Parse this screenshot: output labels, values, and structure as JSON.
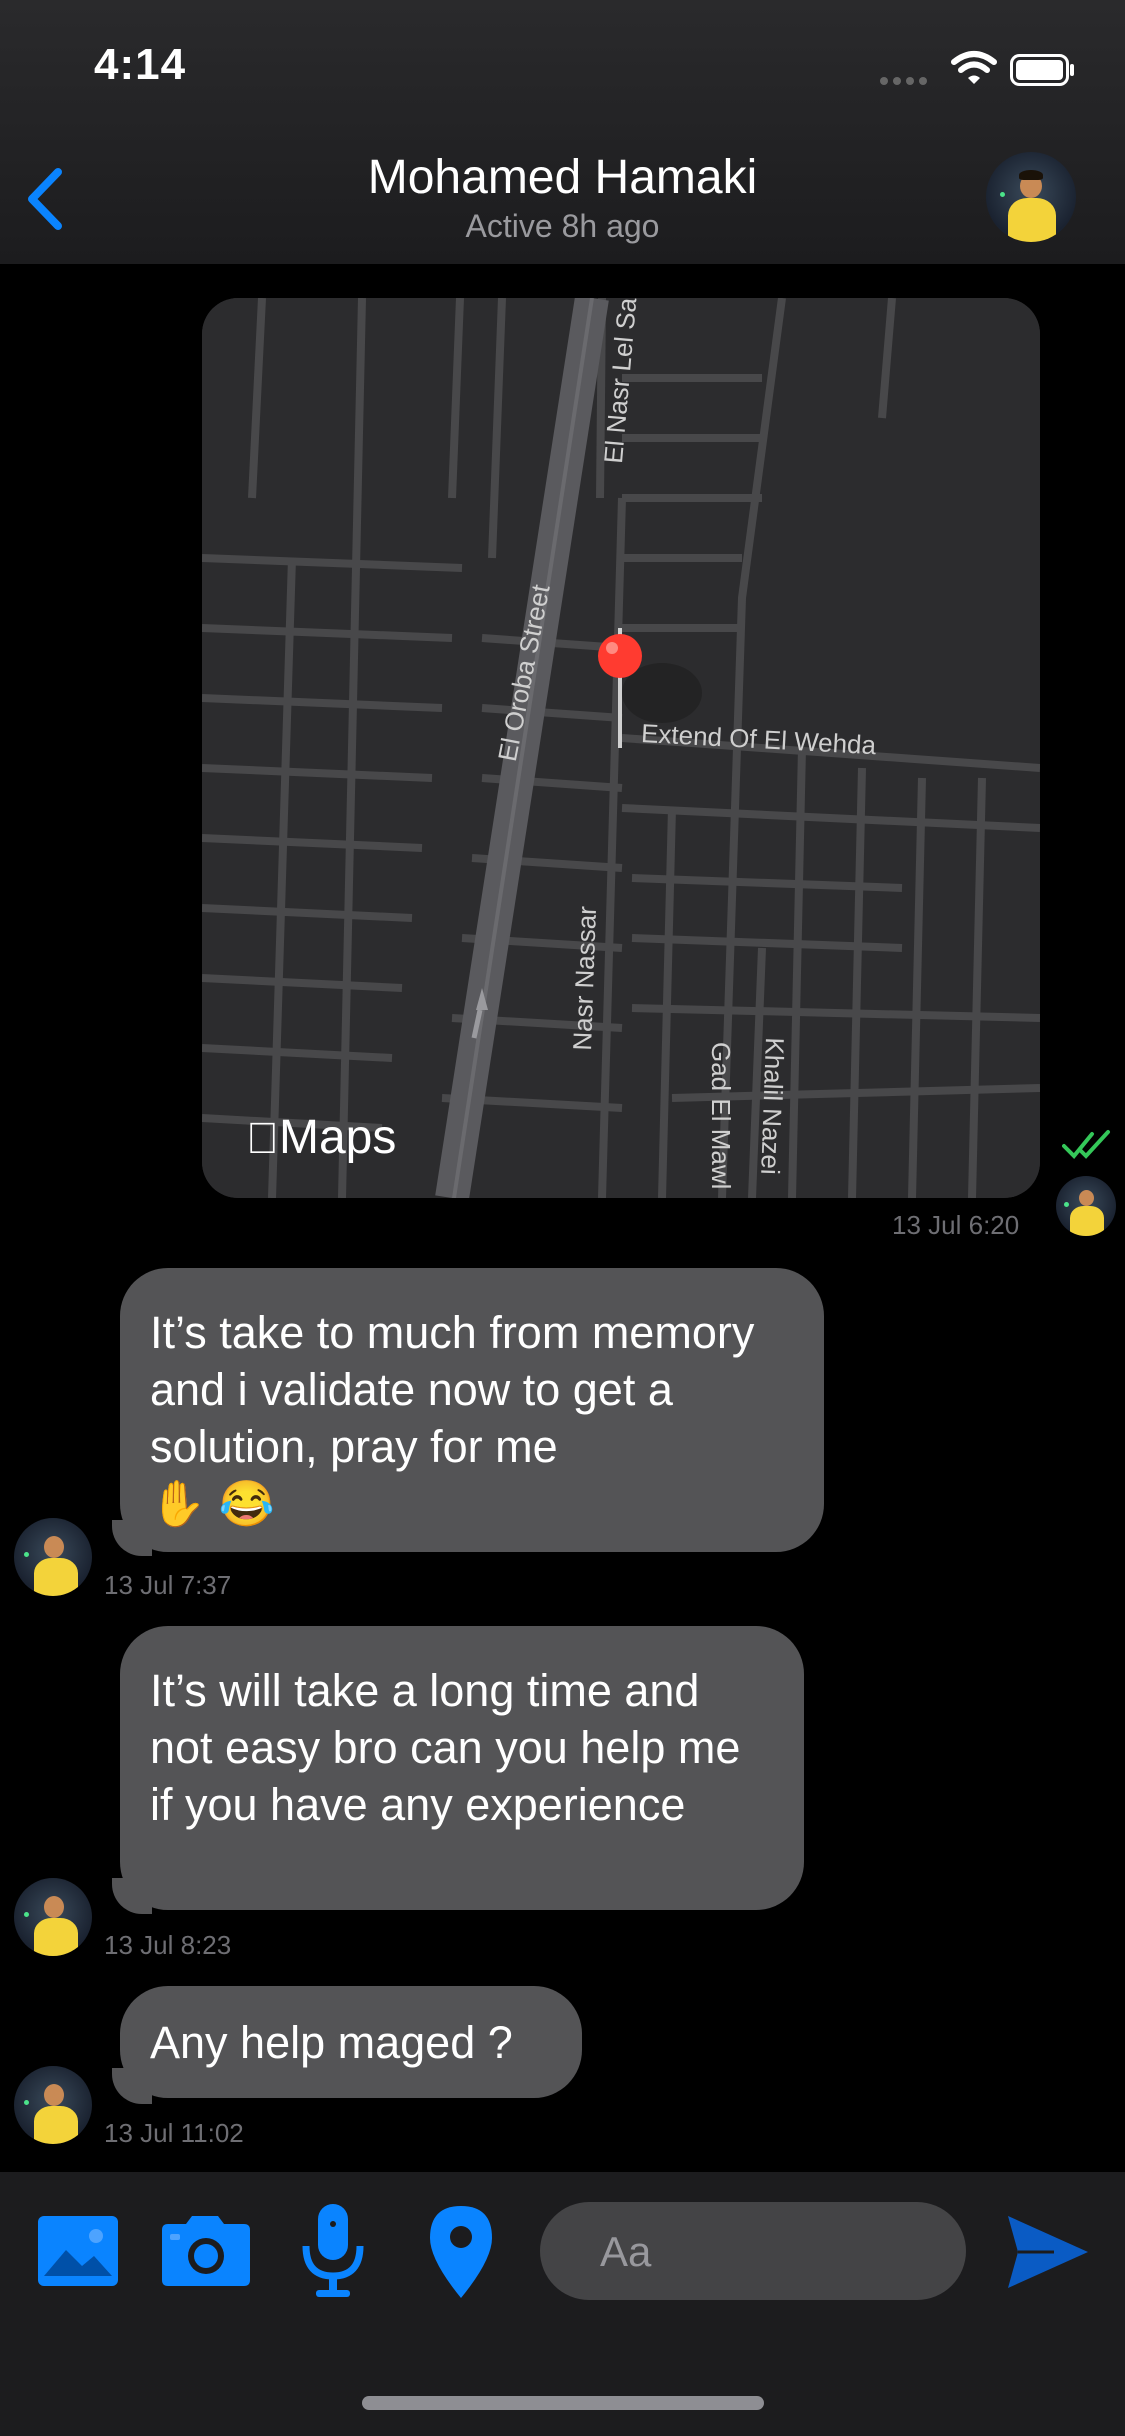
{
  "status_bar": {
    "time": "4:14"
  },
  "header": {
    "contact_name": "Mohamed Hamaki",
    "status": "Active 8h ago",
    "back_icon": "chevron-left-icon"
  },
  "map": {
    "app_label": "Maps",
    "streets": [
      "El Nasr Lel Sag",
      "El Oroba Street",
      "Extend Of El Wehda",
      "Nasr Nassar",
      "Gad El Mawl",
      "Khalil Nazei"
    ],
    "timestamp": "13 Jul 6:20",
    "read_receipt": "double-check-icon"
  },
  "messages": [
    {
      "text": "It’s take to much from memory and i validate now to get a solution, pray for me",
      "emoji": "✋ 😂",
      "time": "13 Jul 7:37"
    },
    {
      "text": "It’s will take a long time and not easy bro can you help me if you have any experience",
      "time": "13 Jul 8:23"
    },
    {
      "text": "Any help maged ?",
      "time": "13 Jul 11:02"
    }
  ],
  "composer": {
    "placeholder": "Aa",
    "icons": [
      "photo-icon",
      "camera-icon",
      "microphone-icon",
      "location-pin-icon",
      "send-icon"
    ]
  },
  "colors": {
    "accent": "#0a84ff",
    "bubble": "#545456",
    "read_check": "#34c759",
    "pin": "#ff3b30"
  }
}
